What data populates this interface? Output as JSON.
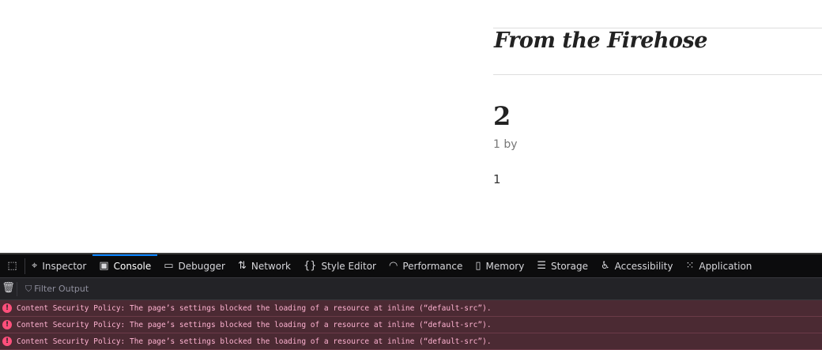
{
  "page": {
    "heading": "From the Firehose",
    "count": "2",
    "byline": "1 by",
    "value": "1"
  },
  "devtools": {
    "tabs": [
      {
        "label": "Inspector",
        "icon": "inspector-icon"
      },
      {
        "label": "Console",
        "icon": "console-icon"
      },
      {
        "label": "Debugger",
        "icon": "debugger-icon"
      },
      {
        "label": "Network",
        "icon": "network-icon"
      },
      {
        "label": "Style Editor",
        "icon": "style-editor-icon"
      },
      {
        "label": "Performance",
        "icon": "performance-icon"
      },
      {
        "label": "Memory",
        "icon": "memory-icon"
      },
      {
        "label": "Storage",
        "icon": "storage-icon"
      },
      {
        "label": "Accessibility",
        "icon": "accessibility-icon"
      },
      {
        "label": "Application",
        "icon": "application-icon"
      }
    ],
    "selected_tab": "Console",
    "filter_placeholder": "Filter Output",
    "messages": [
      "Content Security Policy: The page’s settings blocked the loading of a resource at inline (“default-src”).",
      "Content Security Policy: The page’s settings blocked the loading of a resource at inline (“default-src”).",
      "Content Security Policy: The page’s settings blocked the loading of a resource at inline (“default-src”)."
    ]
  }
}
